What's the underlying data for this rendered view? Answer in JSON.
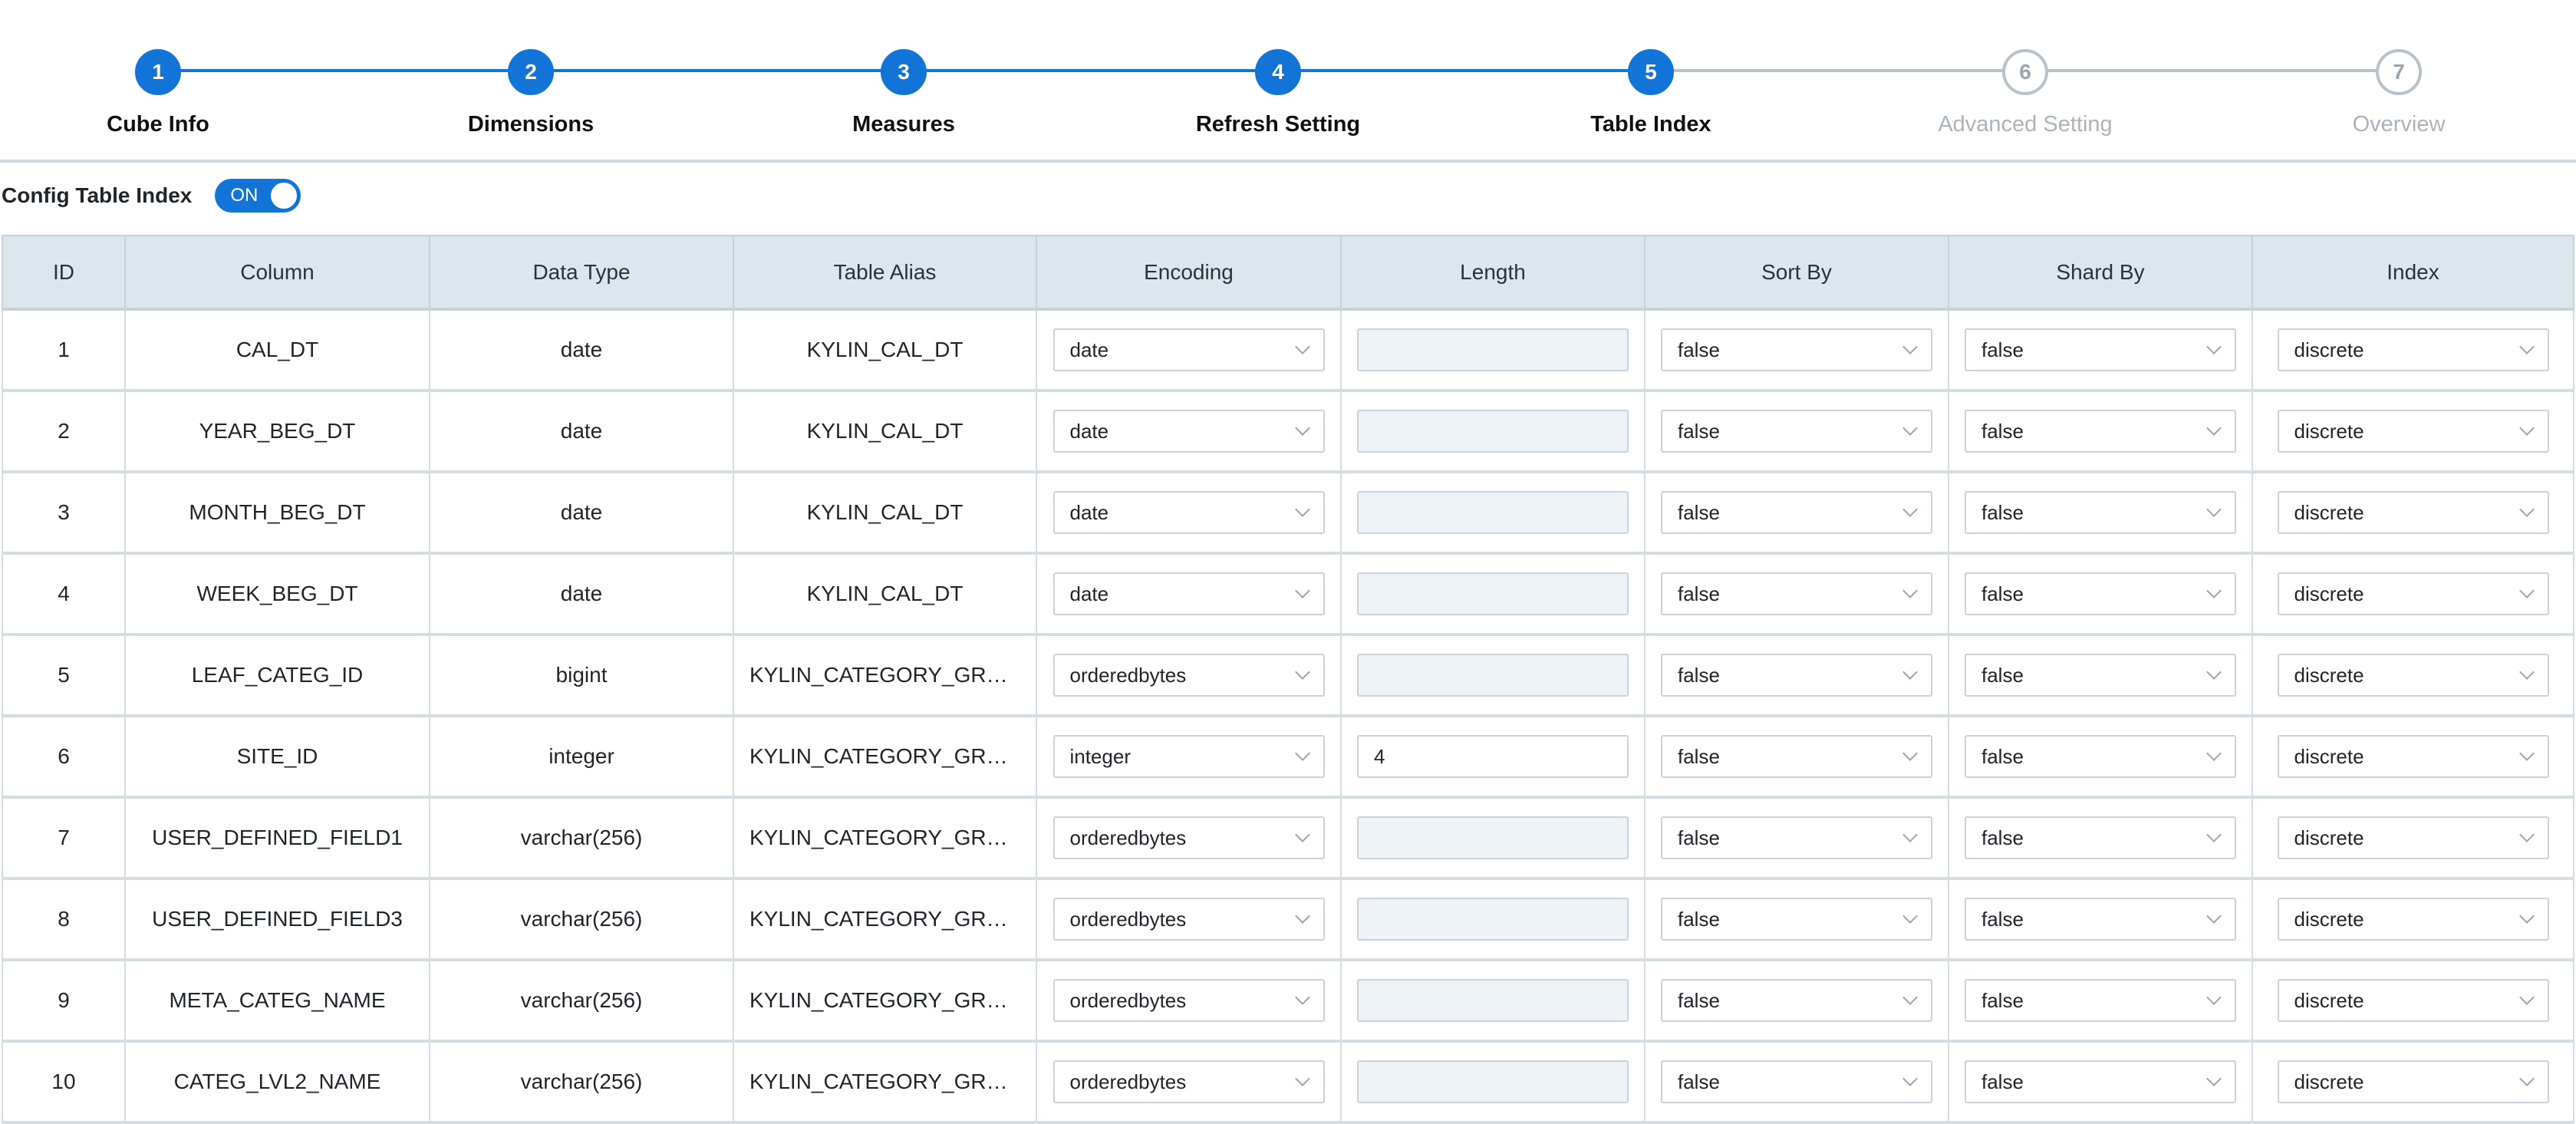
{
  "stepper": {
    "steps": [
      {
        "num": "1",
        "label": "Cube Info",
        "state": "done"
      },
      {
        "num": "2",
        "label": "Dimensions",
        "state": "done"
      },
      {
        "num": "3",
        "label": "Measures",
        "state": "done"
      },
      {
        "num": "4",
        "label": "Refresh Setting",
        "state": "done"
      },
      {
        "num": "5",
        "label": "Table Index",
        "state": "active"
      },
      {
        "num": "6",
        "label": "Advanced Setting",
        "state": "todo"
      },
      {
        "num": "7",
        "label": "Overview",
        "state": "todo"
      }
    ]
  },
  "config": {
    "label": "Config Table Index",
    "toggle": "ON"
  },
  "table": {
    "headers": [
      "ID",
      "Column",
      "Data Type",
      "Table Alias",
      "Encoding",
      "Length",
      "Sort By",
      "Shard By",
      "Index"
    ],
    "rows": [
      {
        "id": "1",
        "column": "CAL_DT",
        "type": "date",
        "alias": "KYLIN_CAL_DT",
        "encoding": "date",
        "length": "",
        "sort": "false",
        "shard": "false",
        "index": "discrete"
      },
      {
        "id": "2",
        "column": "YEAR_BEG_DT",
        "type": "date",
        "alias": "KYLIN_CAL_DT",
        "encoding": "date",
        "length": "",
        "sort": "false",
        "shard": "false",
        "index": "discrete"
      },
      {
        "id": "3",
        "column": "MONTH_BEG_DT",
        "type": "date",
        "alias": "KYLIN_CAL_DT",
        "encoding": "date",
        "length": "",
        "sort": "false",
        "shard": "false",
        "index": "discrete"
      },
      {
        "id": "4",
        "column": "WEEK_BEG_DT",
        "type": "date",
        "alias": "KYLIN_CAL_DT",
        "encoding": "date",
        "length": "",
        "sort": "false",
        "shard": "false",
        "index": "discrete"
      },
      {
        "id": "5",
        "column": "LEAF_CATEG_ID",
        "type": "bigint",
        "alias": "KYLIN_CATEGORY_GRO...",
        "encoding": "orderedbytes",
        "length": "",
        "sort": "false",
        "shard": "false",
        "index": "discrete"
      },
      {
        "id": "6",
        "column": "SITE_ID",
        "type": "integer",
        "alias": "KYLIN_CATEGORY_GRO...",
        "encoding": "integer",
        "length": "4",
        "sort": "false",
        "shard": "false",
        "index": "discrete"
      },
      {
        "id": "7",
        "column": "USER_DEFINED_FIELD1",
        "type": "varchar(256)",
        "alias": "KYLIN_CATEGORY_GRO...",
        "encoding": "orderedbytes",
        "length": "",
        "sort": "false",
        "shard": "false",
        "index": "discrete"
      },
      {
        "id": "8",
        "column": "USER_DEFINED_FIELD3",
        "type": "varchar(256)",
        "alias": "KYLIN_CATEGORY_GRO...",
        "encoding": "orderedbytes",
        "length": "",
        "sort": "false",
        "shard": "false",
        "index": "discrete"
      },
      {
        "id": "9",
        "column": "META_CATEG_NAME",
        "type": "varchar(256)",
        "alias": "KYLIN_CATEGORY_GRO...",
        "encoding": "orderedbytes",
        "length": "",
        "sort": "false",
        "shard": "false",
        "index": "discrete"
      },
      {
        "id": "10",
        "column": "CATEG_LVL2_NAME",
        "type": "varchar(256)",
        "alias": "KYLIN_CATEGORY_GRO...",
        "encoding": "orderedbytes",
        "length": "",
        "sort": "false",
        "shard": "false",
        "index": "discrete"
      }
    ]
  },
  "colors": {
    "accent": "#1274d6",
    "inactive": "#b8c3c9",
    "header_bg": "#dce6ed"
  }
}
